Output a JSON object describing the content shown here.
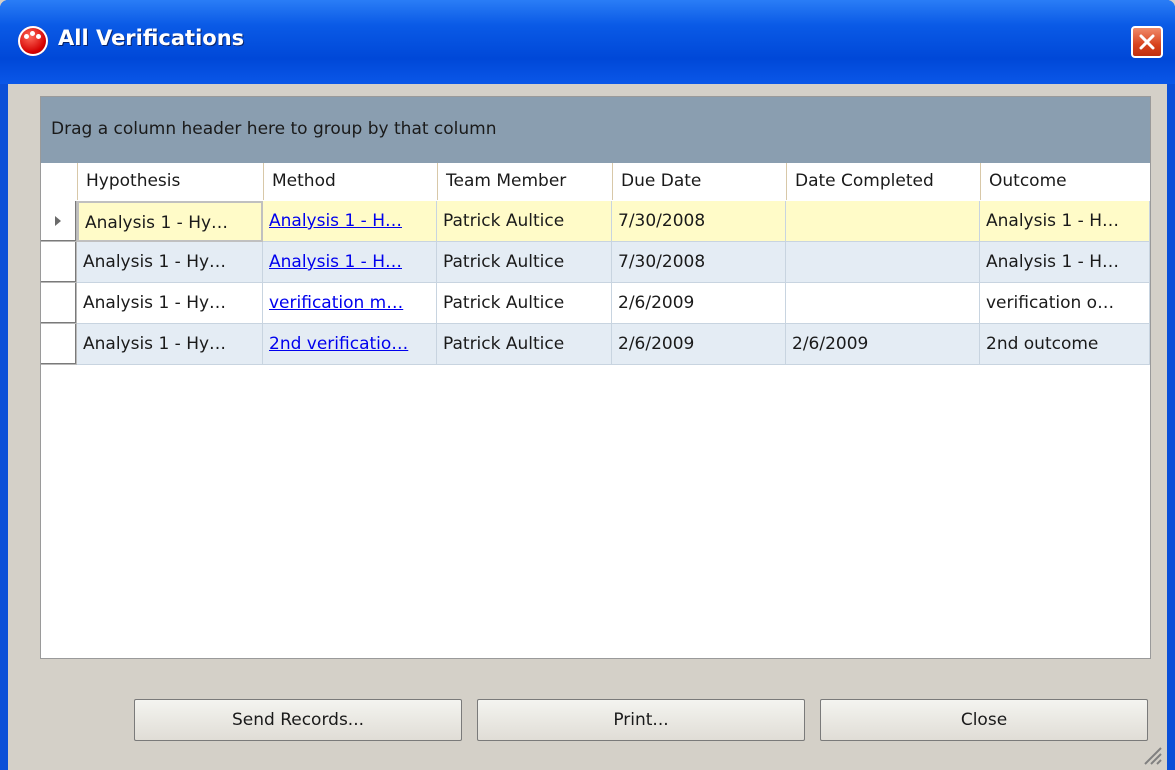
{
  "window": {
    "title": "All Verifications"
  },
  "grid": {
    "group_hint": "Drag a column header here to group by that column",
    "columns": [
      "Hypothesis",
      "Method",
      "Team Member",
      "Due Date",
      "Date Completed",
      "Outcome"
    ],
    "rows": [
      [
        "Analysis 1 - Hy…",
        "Analysis 1 - H…",
        "Patrick Aultice",
        "7/30/2008",
        "",
        "Analysis 1 - H…"
      ],
      [
        "Analysis 1 - Hy…",
        "Analysis 1 - H…",
        "Patrick Aultice",
        "7/30/2008",
        "",
        "Analysis 1 - H…"
      ],
      [
        "Analysis 1 - Hy…",
        "verification m…",
        "Patrick Aultice",
        "2/6/2009",
        "",
        "verification o…"
      ],
      [
        "Analysis 1 - Hy…",
        "2nd verificatio…",
        "Patrick Aultice",
        "2/6/2009",
        "2/6/2009",
        "2nd outcome"
      ]
    ],
    "selected_row": 0
  },
  "buttons": {
    "send": "Send Records...",
    "print": "Print...",
    "close": "Close"
  },
  "colors": {
    "titlebar": "#0a5ae6",
    "group_panel": "#8a9eb0",
    "selected_row": "#fffbc8",
    "alt_row": "#e4ecf4",
    "link": "#0000ee"
  },
  "icons": {
    "app": "red-dot-logo-icon",
    "close": "close-x-icon",
    "row": "row-selector-arrow-icon",
    "grip": "resize-grip-icon"
  }
}
